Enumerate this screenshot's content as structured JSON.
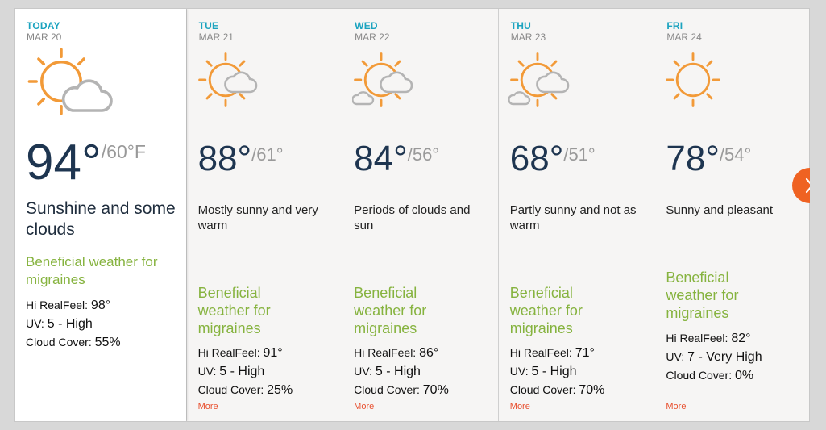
{
  "forecast": [
    {
      "day": "TODAY",
      "date": "MAR 20",
      "icon": "sun-with-cloud-icon",
      "hi": "94°",
      "lo": "/60°F",
      "phrase": "Sunshine and some clouds",
      "health": "Beneficial weather for migraines",
      "realfeel_label": "Hi RealFeel: ",
      "realfeel": "98°",
      "uv_label": "UV: ",
      "uv": "5 - High",
      "cloud_label": "Cloud Cover: ",
      "cloud": "55%"
    },
    {
      "day": "TUE",
      "date": "MAR 21",
      "icon": "sun-with-cloud-icon",
      "hi": "88°",
      "lo": "/61°",
      "phrase": "Mostly sunny and very warm",
      "health": "Beneficial weather for migraines",
      "realfeel_label": "Hi RealFeel: ",
      "realfeel": "91°",
      "uv_label": "UV: ",
      "uv": "5 - High",
      "cloud_label": "Cloud Cover: ",
      "cloud": "25%",
      "more": "More"
    },
    {
      "day": "WED",
      "date": "MAR 22",
      "icon": "sun-with-clouds-icon",
      "hi": "84°",
      "lo": "/56°",
      "phrase": "Periods of clouds and sun",
      "health": "Beneficial weather for migraines",
      "realfeel_label": "Hi RealFeel: ",
      "realfeel": "86°",
      "uv_label": "UV: ",
      "uv": "5 - High",
      "cloud_label": "Cloud Cover: ",
      "cloud": "70%",
      "more": "More"
    },
    {
      "day": "THU",
      "date": "MAR 23",
      "icon": "sun-with-clouds-icon",
      "hi": "68°",
      "lo": "/51°",
      "phrase": "Partly sunny and not as warm",
      "health": "Beneficial weather for migraines",
      "realfeel_label": "Hi RealFeel: ",
      "realfeel": "71°",
      "uv_label": "UV: ",
      "uv": "5 - High",
      "cloud_label": "Cloud Cover: ",
      "cloud": "70%",
      "more": "More"
    },
    {
      "day": "FRI",
      "date": "MAR 24",
      "icon": "sun-icon",
      "hi": "78°",
      "lo": "/54°",
      "phrase": "Sunny and pleasant",
      "health": "Beneficial weather for migraines",
      "realfeel_label": "Hi RealFeel: ",
      "realfeel": "82°",
      "uv_label": "UV: ",
      "uv": "7 - Very High",
      "cloud_label": "Cloud Cover: ",
      "cloud": "0%",
      "more": "More"
    }
  ],
  "next_button": {
    "icon": "chevron-right-icon"
  },
  "colors": {
    "day_label": "#1ba3bf",
    "health_text": "#86b33f",
    "more_link": "#e8502f",
    "next_button": "#ef6222",
    "sun": "#f29a38",
    "cloud": "#b4b4b4",
    "temp_hi": "#1e3550"
  }
}
